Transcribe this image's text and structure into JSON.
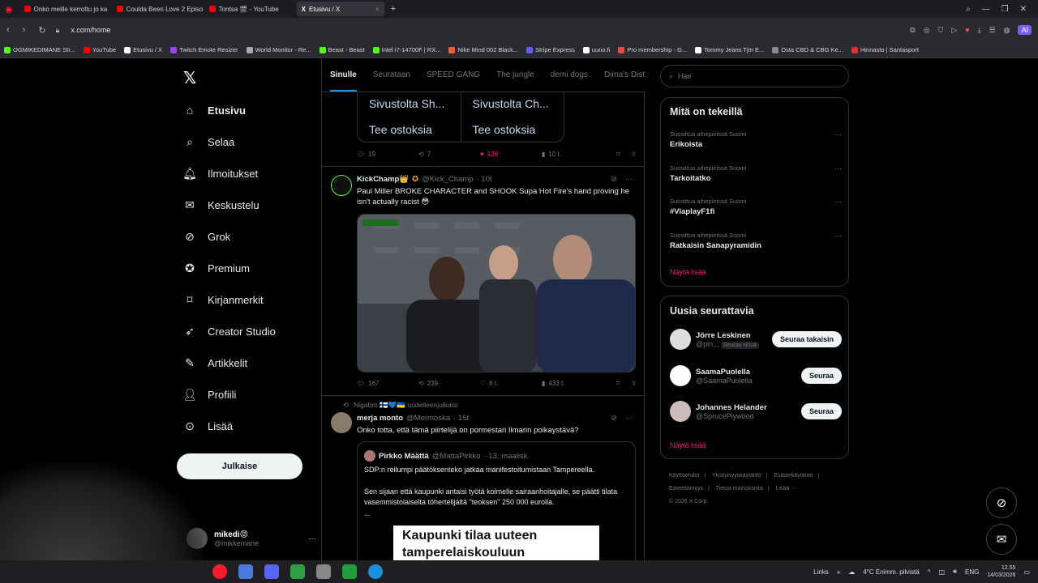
{
  "browser": {
    "tabs": [
      {
        "title": "Onko meille kerrottu jo ka",
        "color": "#ff0000"
      },
      {
        "title": "Coulda Been Love 2 Episo",
        "color": "#ff0000"
      },
      {
        "title": "Tontsa 🎬 - YouTube",
        "color": "#ff0000"
      },
      {
        "title": "Etusivu / X",
        "color": "#ffffff"
      }
    ],
    "url": "x.com/home",
    "ai_label": "AI"
  },
  "bookmarks": [
    {
      "label": "OGMIKEDIMANE Str...",
      "color": "#53fc18"
    },
    {
      "label": "YouTube",
      "color": "#ff0000"
    },
    {
      "label": "Etusivu / X",
      "color": "#ffffff"
    },
    {
      "label": "Twitch Emote Resizer",
      "color": "#9146ff"
    },
    {
      "label": "World Monitor - Re...",
      "color": "#aaaaaa"
    },
    {
      "label": "Beast - Beast",
      "color": "#53fc18"
    },
    {
      "label": "Intel i7-14700F | RX...",
      "color": "#53fc18"
    },
    {
      "label": "Nike Mind 002 Black...",
      "color": "#ff5a36"
    },
    {
      "label": "Stripe Express",
      "color": "#635bff"
    },
    {
      "label": "uuno.fi",
      "color": "#ffffff"
    },
    {
      "label": "Pro membership - G...",
      "color": "#ff4444"
    },
    {
      "label": "Tommy Jeans Tjm E...",
      "color": "#ffffff"
    },
    {
      "label": "Osta CBD & CBG Ke...",
      "color": "#888888"
    },
    {
      "label": "Hinnasto | Santasport",
      "color": "#e03030"
    }
  ],
  "nav": {
    "items": [
      "Etusivu",
      "Selaa",
      "Ilmoitukset",
      "Keskustelu",
      "Grok",
      "Premium",
      "Kirjanmerkit",
      "Creator Studio",
      "Artikkelit",
      "Profiili",
      "Lisää"
    ],
    "post_label": "Julkaise",
    "user_name": "mikedi😡",
    "user_handle": "@mikkemane"
  },
  "feed": {
    "tabs": [
      "Sinulle",
      "Seurataan",
      "SPEED GANG",
      "The jungle",
      "demi dogs",
      "Dima's Dist"
    ],
    "shop": {
      "cards": [
        {
          "title": "Sivustolta Sh...",
          "cta": "Tee ostoksia"
        },
        {
          "title": "Sivustolta Ch...",
          "cta": "Tee ostoksia"
        }
      ],
      "stats": {
        "replies": "19",
        "reposts": "7",
        "likes": "126",
        "views": "10 t."
      }
    },
    "tweet1": {
      "name": "KickChamp👑",
      "handle": "@Kick_Champ",
      "time": "· 10t",
      "text": "Paul Miller BROKE CHARACTER and SHOOK Supa Hot Fire's hand proving he isn't actually racist 😳",
      "stats": {
        "replies": "167",
        "reposts": "239",
        "likes": "8 t.",
        "views": "433 t."
      }
    },
    "tweet2": {
      "repost_by": "Nigabro 🇫🇮💙🇺🇦 uudelleenjulkaisi",
      "name": "merja monto",
      "handle": "@Mermoska",
      "time": "· 15t",
      "text": "Onko totta, että tämä piirtelijä on pormestari Ilmarin poikaystävä?",
      "quote": {
        "name": "Pirkko Määttä",
        "handle": "@MattaPirkko",
        "time": "· 13. maalisk.",
        "line1": "SDP:n reilumpi päätöksenteko jatkaa manifestoitumistaan Tampereella.",
        "line2": "Sen sijaan  että kaupunki antaisi työtä kolmelle sairaanhoitajalle, se päätti tilata vasemmistolaiselta töhertelijältä \"teoksen\" 250 000 eurolla.",
        "line3": "...",
        "card_text": "Kaupunki tilaa uuteen tamperelaiskouluun"
      }
    }
  },
  "right": {
    "search_placeholder": "Hae",
    "trends_title": "Mitä on tekeillä",
    "trends": [
      {
        "context": "Suosittua aihepiirissä Suomi",
        "topic": "Erikoista"
      },
      {
        "context": "Suosittua aihepiirissä Suomi",
        "topic": "Tarkoitatko"
      },
      {
        "context": "Suosittua aihepiirissä Suomi",
        "topic": "#ViaplayF1fi"
      },
      {
        "context": "Suosittua aihepiirissä Suomi",
        "topic": "Ratkaisin Sanapyramidin"
      }
    ],
    "show_more": "Näytä lisää",
    "who_title": "Uusia seurattavia",
    "who": [
      {
        "name": "Jörre Leskinen",
        "handle": "@pin...",
        "badge": "Seuraa sinua",
        "button": "Seuraa takaisin"
      },
      {
        "name": "SaamaPuolella",
        "handle": "@SaamaPuolella",
        "badge": "",
        "button": "Seuraa"
      },
      {
        "name": "Johannes Helander",
        "handle": "@SprucePlywood",
        "badge": "",
        "button": "Seuraa"
      }
    ],
    "footer": [
      "Käyttöehdot",
      "Yksityisyyskäytäntö",
      "Evästekäytäntö",
      "Esteettömyys",
      "Tietoa mainoksista",
      "Lisää ···",
      "© 2026 X Corp."
    ]
  },
  "taskbar": {
    "links": "Links",
    "weather": "4°C  Enimm. pilvistä",
    "lang": "ENG",
    "time": "12.55",
    "date": "14/03/2026"
  }
}
